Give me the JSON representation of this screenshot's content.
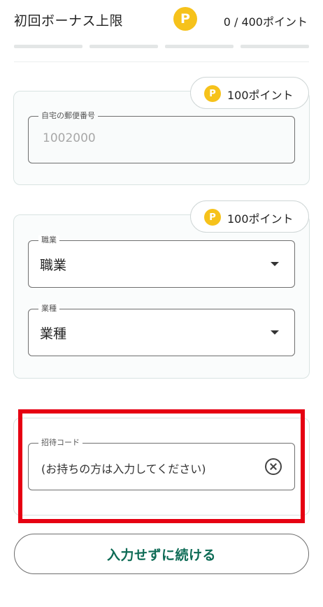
{
  "header": {
    "title": "初回ボーナス上限",
    "coin_symbol": "P",
    "points": "0 / 400ポイント"
  },
  "cards": [
    {
      "badge": {
        "coin_symbol": "P",
        "label": "100ポイント"
      },
      "fields": [
        {
          "label": "自宅の郵便番号",
          "placeholder": "1002000"
        }
      ]
    },
    {
      "badge": {
        "coin_symbol": "P",
        "label": "100ポイント"
      },
      "fields": [
        {
          "label": "職業",
          "value": "職業"
        },
        {
          "label": "業種",
          "value": "業種"
        }
      ]
    }
  ],
  "invite": {
    "label": "招待コード",
    "placeholder": "(お持ちの方は入力してください)"
  },
  "continue_button": "入力せずに続ける",
  "colors": {
    "accent_green": "#0d6b55",
    "coin_yellow": "#f6c21b",
    "highlight_red": "#e60012"
  }
}
